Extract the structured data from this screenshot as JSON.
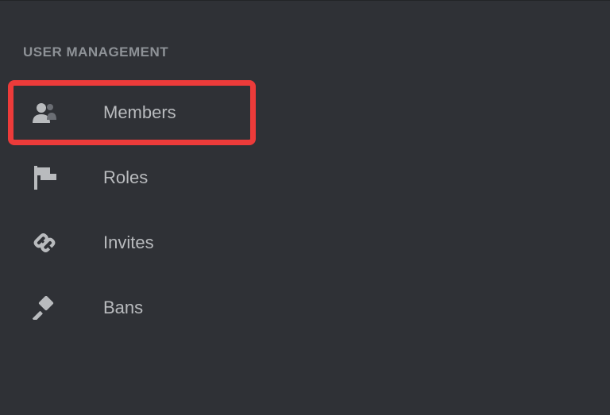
{
  "section": {
    "header": "USER MANAGEMENT"
  },
  "menu": {
    "members": {
      "label": "Members"
    },
    "roles": {
      "label": "Roles"
    },
    "invites": {
      "label": "Invites"
    },
    "bans": {
      "label": "Bans"
    }
  }
}
